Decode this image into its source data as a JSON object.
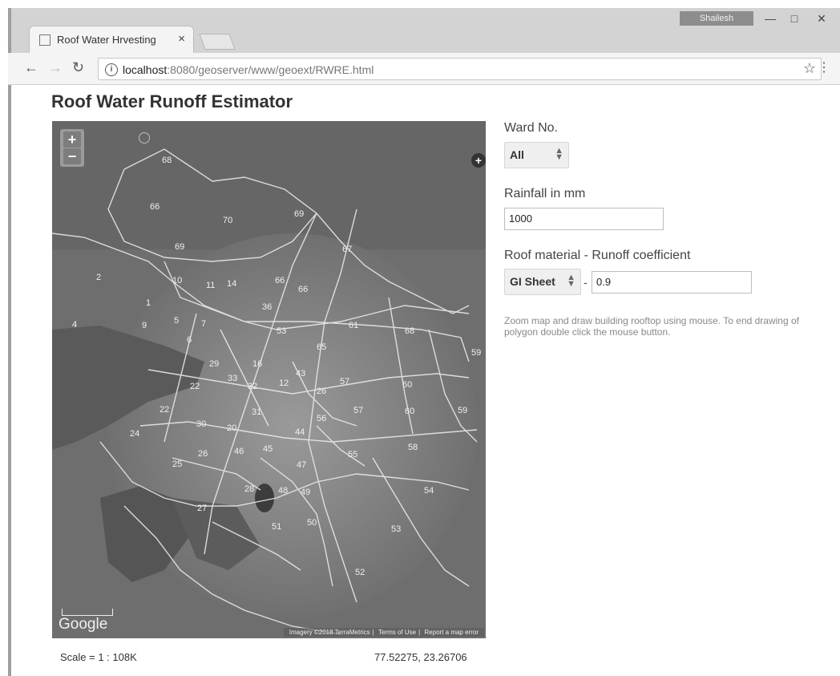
{
  "browser": {
    "user": "Shailesh",
    "tab_title": "Roof Water Hrvesting",
    "url_host": "localhost",
    "url_path": ":8080/geoserver/www/geoext/RWRE.html"
  },
  "page": {
    "title": "Roof Water Runoff Estimator"
  },
  "map": {
    "zoom_in": "+",
    "zoom_out": "−",
    "google_label": "Google",
    "attribution": [
      "Imagery ©2018 TerraMetrics",
      "Terms of Use",
      "Report a map error"
    ],
    "ward_labels": [
      "68",
      "66",
      "70",
      "69",
      "67",
      "69",
      "2",
      "10",
      "11",
      "14",
      "66",
      "66",
      "36",
      "4",
      "1",
      "9",
      "7",
      "5",
      "6",
      "53",
      "65",
      "61",
      "68",
      "59",
      "16",
      "29",
      "33",
      "22",
      "32",
      "12",
      "43",
      "57",
      "60",
      "26",
      "31",
      "56",
      "57",
      "60",
      "59",
      "22",
      "30",
      "20",
      "24",
      "45",
      "44",
      "58",
      "46",
      "55",
      "25",
      "26",
      "47",
      "28",
      "48",
      "49",
      "54",
      "27",
      "51",
      "50",
      "53",
      "52"
    ],
    "scale_text": "Scale = 1 : 108K",
    "coordinates": "77.52275, 23.26706"
  },
  "form": {
    "ward_label": "Ward No.",
    "ward_value": "All",
    "rainfall_label": "Rainfall in mm",
    "rainfall_value": "1000",
    "roof_label": "Roof material - Runoff coefficient",
    "roof_material_value": "GI Sheet",
    "dash": "-",
    "runoff_coefficient_value": "0.9",
    "help_text": "Zoom map and draw building rooftop using mouse. To end drawing of polygon double click the mouse button."
  }
}
